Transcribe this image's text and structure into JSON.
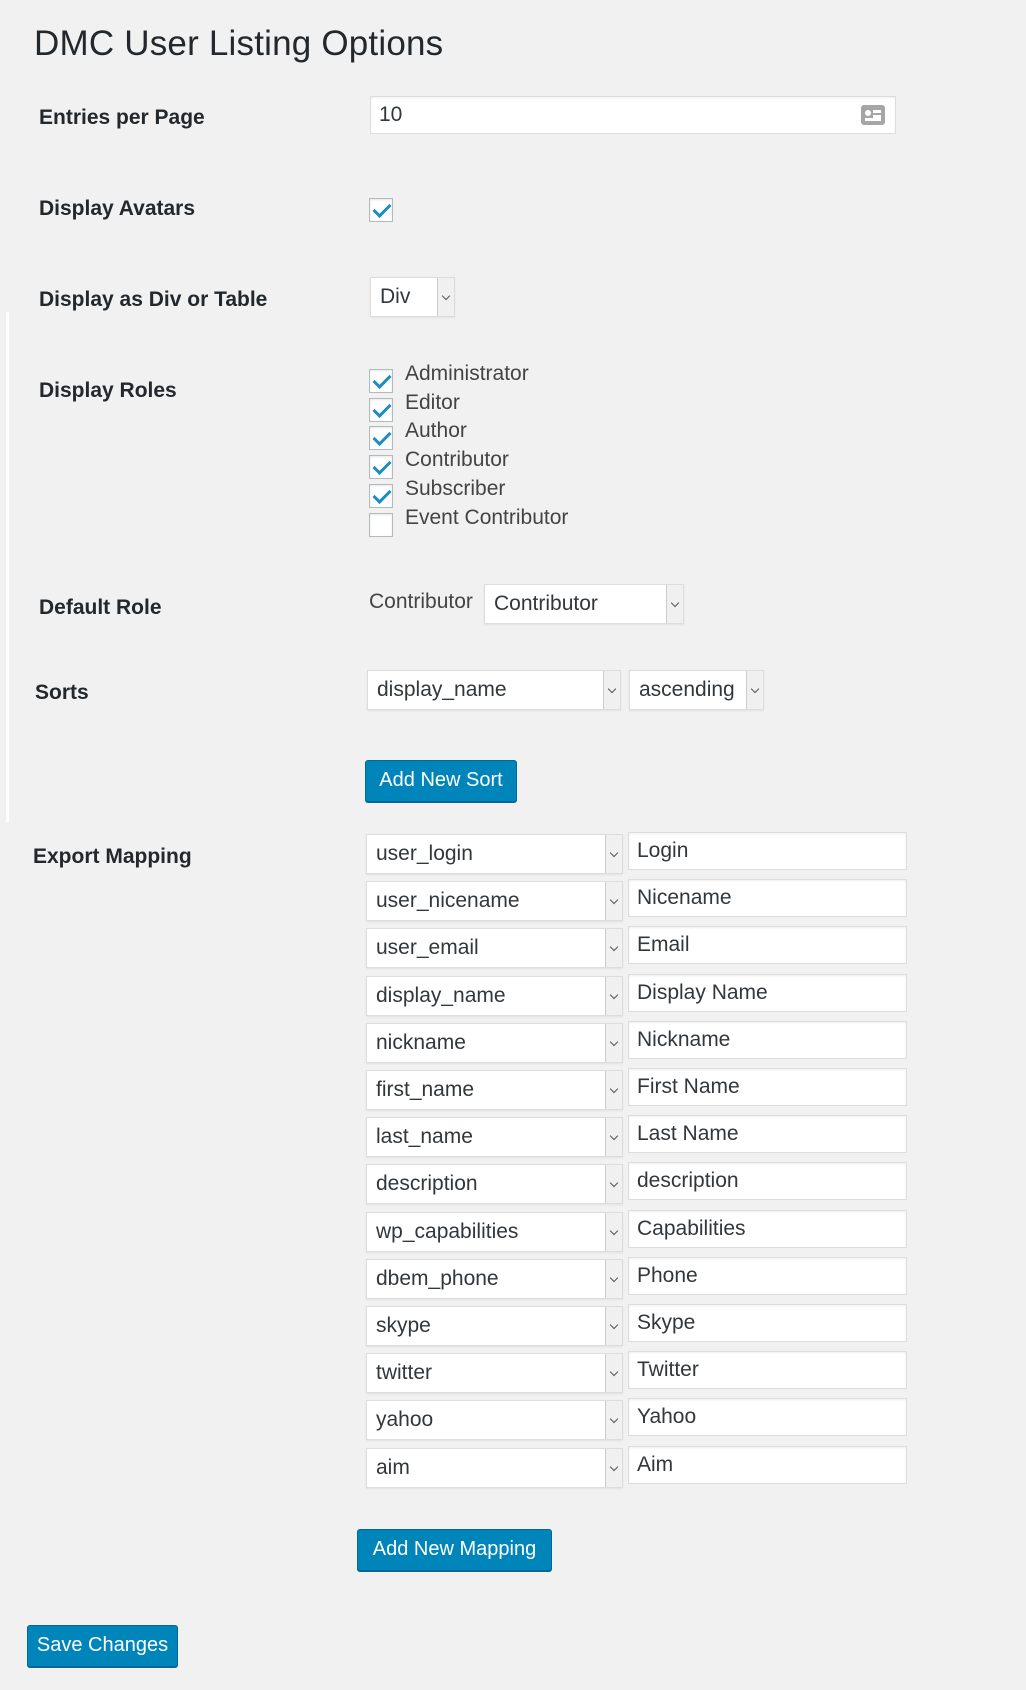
{
  "page": {
    "title": "DMC User Listing Options"
  },
  "entries_per_page": {
    "label": "Entries per Page",
    "value": "10"
  },
  "display_avatars": {
    "label": "Display Avatars",
    "checked": true
  },
  "display_as": {
    "label": "Display as Div or Table",
    "selected": "Div"
  },
  "display_roles": {
    "label": "Display Roles",
    "roles": [
      {
        "label": "Administrator",
        "checked": true
      },
      {
        "label": "Editor",
        "checked": true
      },
      {
        "label": "Author",
        "checked": true
      },
      {
        "label": "Contributor",
        "checked": true
      },
      {
        "label": "Subscriber",
        "checked": true
      },
      {
        "label": "Event Contributor",
        "checked": false
      }
    ]
  },
  "default_role": {
    "label": "Default Role",
    "current_text": "Contributor",
    "selected": "Contributor"
  },
  "sorts": {
    "label": "Sorts",
    "field": "display_name",
    "order": "ascending",
    "add_button": "Add New Sort"
  },
  "export_mapping": {
    "label": "Export Mapping",
    "rows": [
      {
        "field": "user_login",
        "name": "Login"
      },
      {
        "field": "user_nicename",
        "name": "Nicename"
      },
      {
        "field": "user_email",
        "name": "Email"
      },
      {
        "field": "display_name",
        "name": "Display Name"
      },
      {
        "field": "nickname",
        "name": "Nickname"
      },
      {
        "field": "first_name",
        "name": "First Name"
      },
      {
        "field": "last_name",
        "name": "Last Name"
      },
      {
        "field": "description",
        "name": "description"
      },
      {
        "field": "wp_capabilities",
        "name": "Capabilities"
      },
      {
        "field": "dbem_phone",
        "name": "Phone"
      },
      {
        "field": "skype",
        "name": "Skype"
      },
      {
        "field": "twitter",
        "name": "Twitter"
      },
      {
        "field": "yahoo",
        "name": "Yahoo"
      },
      {
        "field": "aim",
        "name": "Aim"
      }
    ],
    "add_button": "Add New Mapping"
  },
  "save_button": "Save Changes",
  "colors": {
    "primary_button": "#0085ba",
    "checkmark": "#1e8cbe",
    "background": "#f1f1f1"
  }
}
